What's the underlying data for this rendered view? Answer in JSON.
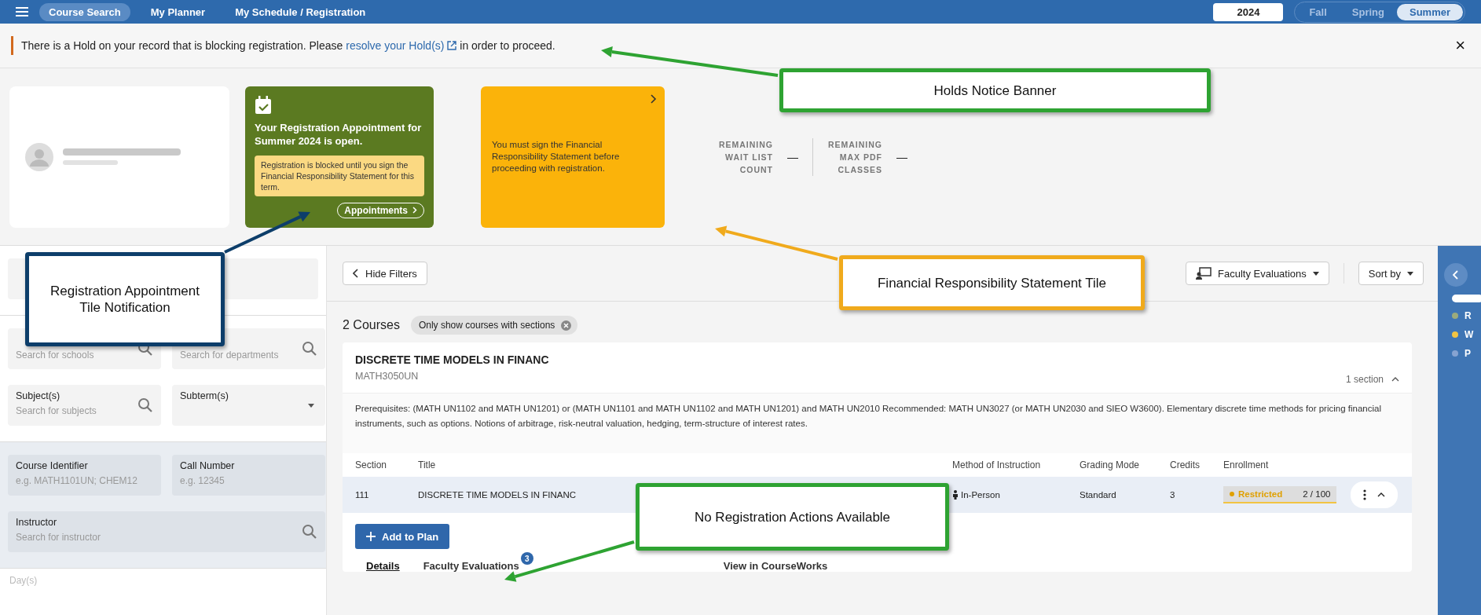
{
  "nav": {
    "items": [
      {
        "label": "Course Search",
        "selected": true
      },
      {
        "label": "My Planner",
        "selected": false
      },
      {
        "label": "My Schedule / Registration",
        "selected": false
      }
    ],
    "year": "2024",
    "terms": [
      {
        "label": "Fall",
        "selected": false
      },
      {
        "label": "Spring",
        "selected": false
      },
      {
        "label": "Summer",
        "selected": true
      }
    ]
  },
  "hold_banner": {
    "text_before": "There is a Hold on your record that is blocking registration. Please ",
    "link": "resolve your Hold(s)",
    "text_after": " in order to proceed.",
    "close": "×"
  },
  "appointment_tile": {
    "title": "Your Registration Appointment for Summer 2024 is open.",
    "notice": "Registration is blocked until you sign the Financial Responsibility Statement for this term.",
    "button": "Appointments"
  },
  "frs_tile": {
    "text": "You must sign the Financial Responsibility Statement before proceeding with registration."
  },
  "stats": [
    {
      "label": "REMAINING WAIT LIST COUNT",
      "value": "—"
    },
    {
      "label": "REMAINING MAX PDF CLASSES",
      "value": "—"
    }
  ],
  "filters": {
    "groups": [
      {
        "shaded": false,
        "fields": [
          {
            "kind": "text",
            "wide": true
          }
        ]
      },
      {
        "shaded": false,
        "fields": [
          {
            "kind": "search",
            "placeholder": "Search for schools"
          },
          {
            "kind": "search",
            "placeholder": "Search for departments"
          },
          {
            "kind": "search",
            "label": "Subject(s)",
            "placeholder": "Search for subjects"
          },
          {
            "kind": "select",
            "label": "Subterm(s)"
          }
        ]
      },
      {
        "shaded": true,
        "fields": [
          {
            "kind": "text",
            "label": "Course Identifier",
            "placeholder": "e.g. MATH1101UN; CHEM12"
          },
          {
            "kind": "text",
            "label": "Call Number",
            "placeholder": "e.g. 12345"
          },
          {
            "kind": "search",
            "label": "Instructor",
            "placeholder": "Search for instructor",
            "wide": true
          }
        ]
      }
    ],
    "days_label": "Day(s)"
  },
  "toolbar": {
    "hide_filters": "Hide Filters",
    "faculty_evaluations": "Faculty Evaluations",
    "sort": "Sort by"
  },
  "results": {
    "count": "2 Courses",
    "chip": "Only show courses with sections"
  },
  "course": {
    "title": "DISCRETE TIME MODELS IN FINANC",
    "code": "MATH3050UN",
    "sections": "1 section",
    "expanded": true,
    "description": "Prerequisites: (MATH UN1102 and MATH UN1201) or (MATH UN1101 and MATH UN1102 and MATH UN1201) and MATH UN2010 Recommended: MATH UN3027 (or MATH UN2030 and SIEO W3600). Elementary discrete time methods for pricing financial instruments, such as options. Notions of arbitrage, risk-neutral valuation, hedging, term-structure of interest rates.",
    "columns": [
      "Section",
      "Title",
      "Method of Instruction",
      "Grading Mode",
      "Credits",
      "Enrollment"
    ],
    "rows": [
      {
        "section": "111",
        "title": "DISCRETE TIME MODELS IN FINANC",
        "method": "In-Person",
        "grading": "Standard",
        "credits": "3",
        "status": "Restricted",
        "count": "2 / 100",
        "expanded": true
      }
    ],
    "add_button": "Add to Plan",
    "tabs": [
      {
        "label": "Details",
        "selected": true
      },
      {
        "label": "Faculty Evaluations",
        "selected": false,
        "badge": "3"
      },
      {
        "label": "View in CourseWorks",
        "selected": false
      }
    ]
  },
  "side_panel": {
    "legend": [
      {
        "label": "R",
        "color": "#9cab7c"
      },
      {
        "label": "W",
        "color": "#f2c443"
      },
      {
        "label": "P",
        "color": "#86a3d1"
      }
    ]
  },
  "annotations": [
    {
      "text": "Holds Notice Banner",
      "color": "#2ea332"
    },
    {
      "text": "Registration Appointment Tile Notification",
      "color": "#0d3e6a"
    },
    {
      "text": "Financial Responsibility Statement Tile",
      "color": "#f0aa1c"
    },
    {
      "text": "No Registration Actions Available",
      "color": "#2ea332"
    }
  ]
}
